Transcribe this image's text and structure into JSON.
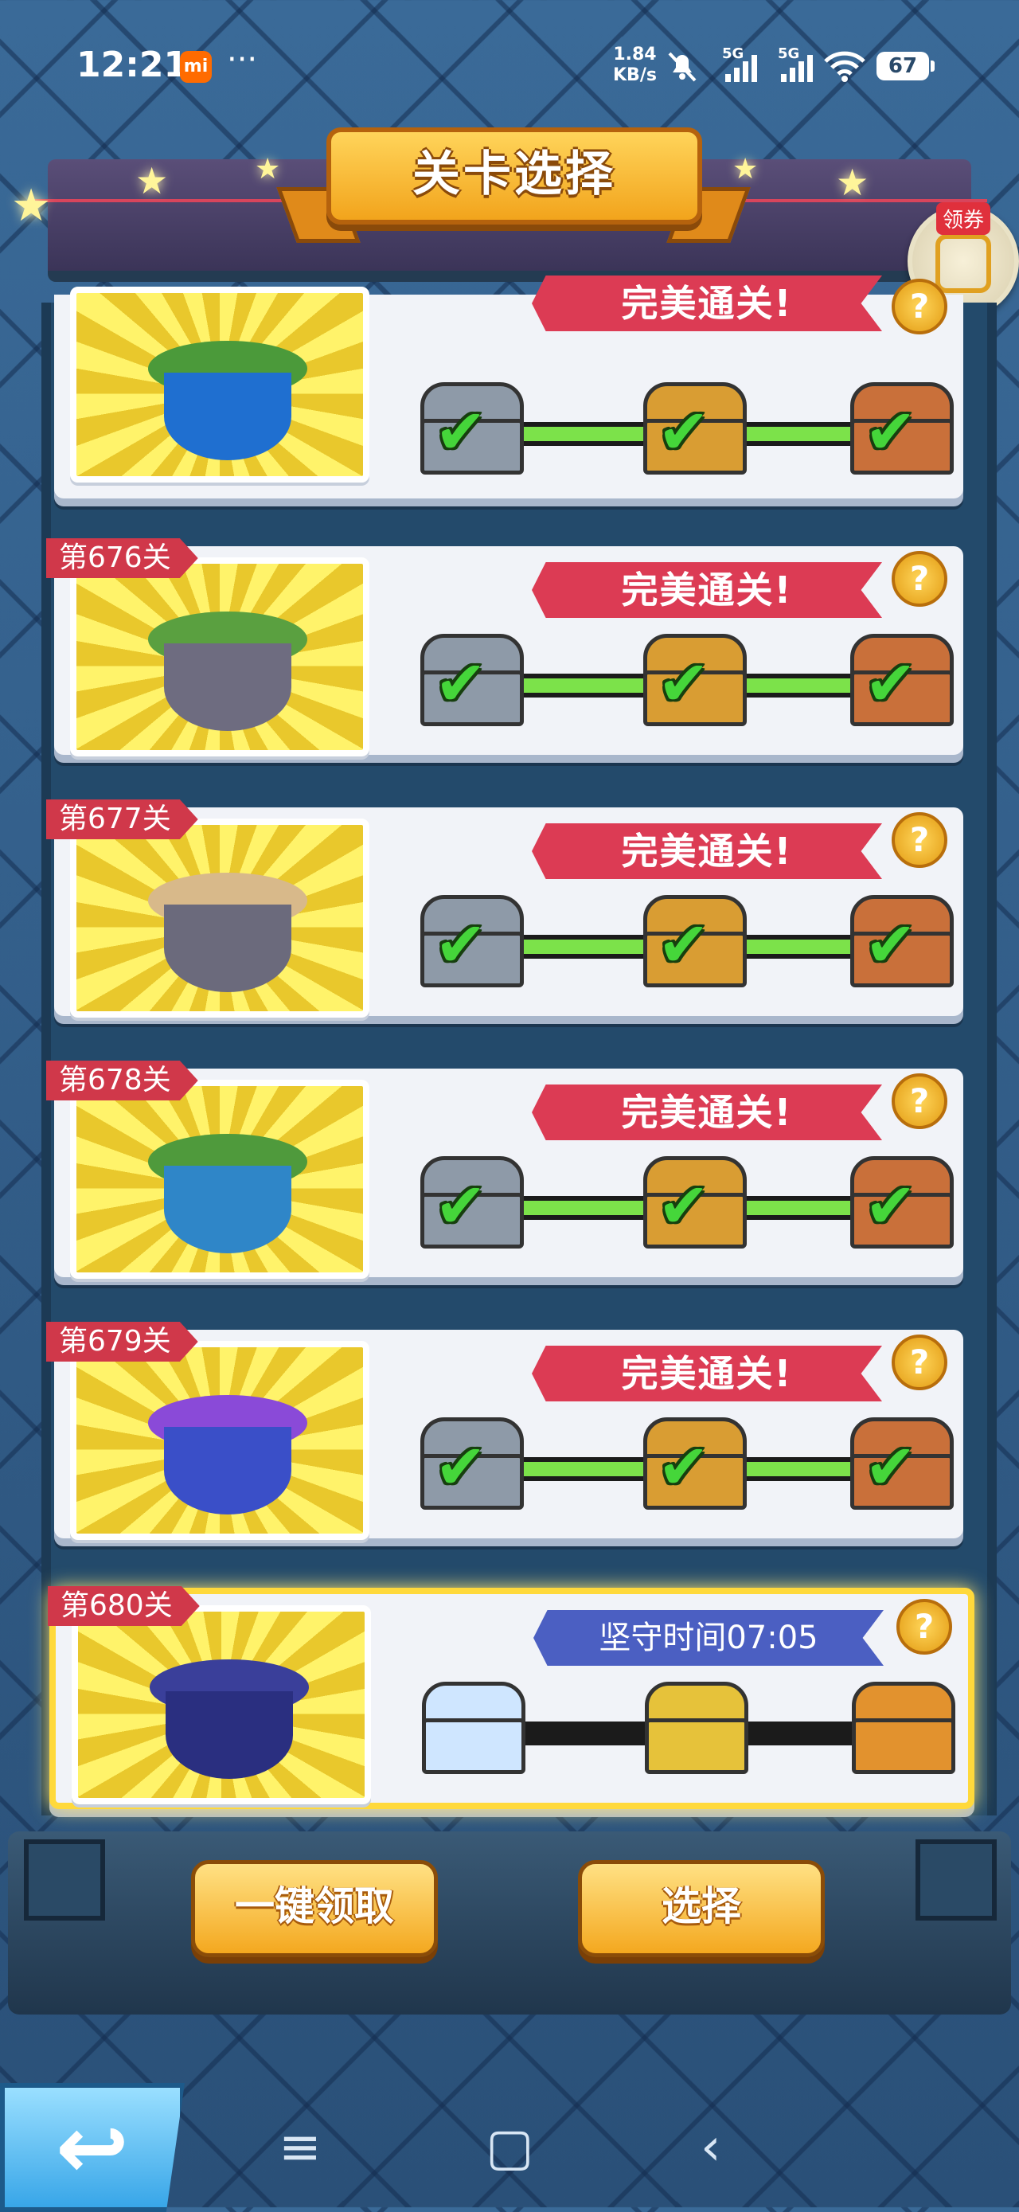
{
  "status": {
    "time": "12:21",
    "mi_badge": "mi",
    "dots": "···",
    "net_speed_value": "1.84",
    "net_speed_unit": "KB/s",
    "signal_1": "5G",
    "signal_2": "5G",
    "battery": "67"
  },
  "header": {
    "title": "关卡选择",
    "coupon_tag": "领券"
  },
  "levels": [
    {
      "label": "",
      "ribbon": "完美通关!",
      "help": "?"
    },
    {
      "label": "第676关",
      "ribbon": "完美通关!",
      "help": "?"
    },
    {
      "label": "第677关",
      "ribbon": "完美通关!",
      "help": "?"
    },
    {
      "label": "第678关",
      "ribbon": "完美通关!",
      "help": "?"
    },
    {
      "label": "第679关",
      "ribbon": "完美通关!",
      "help": "?"
    },
    {
      "label": "第680关",
      "ribbon": "坚守时间07:05",
      "help": "?"
    }
  ],
  "buttons": {
    "claim_all": "一键领取",
    "select": "选择"
  },
  "nav": {
    "back": "↩",
    "menu": "≡",
    "home": "▢",
    "back_arrow": "‹"
  },
  "colors": {
    "ribbon_complete": "#dc3b54",
    "ribbon_current": "#4b5fc2",
    "progress_done": "#7ce24a",
    "highlight": "#ffd93b"
  }
}
